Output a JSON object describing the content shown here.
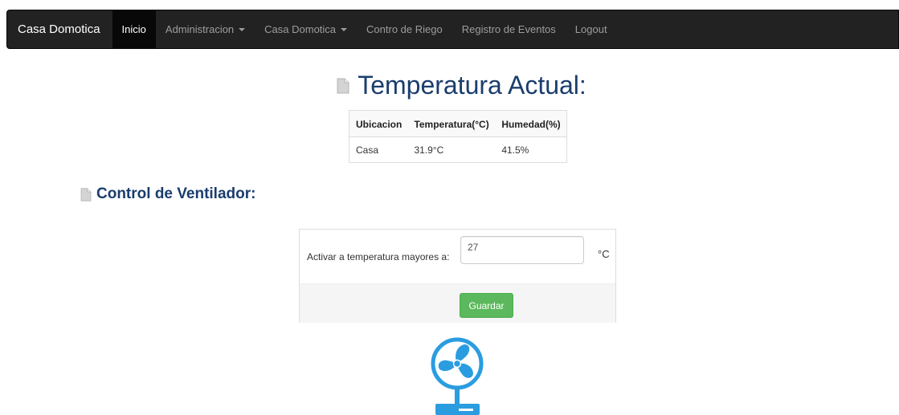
{
  "navbar": {
    "brand": "Casa Domotica",
    "items": [
      {
        "label": "Inicio",
        "active": true,
        "dropdown": false
      },
      {
        "label": "Administracion",
        "active": false,
        "dropdown": true
      },
      {
        "label": "Casa Domotica",
        "active": false,
        "dropdown": true
      },
      {
        "label": "Contro de Riego",
        "active": false,
        "dropdown": false
      },
      {
        "label": "Registro de Eventos",
        "active": false,
        "dropdown": false
      },
      {
        "label": "Logout",
        "active": false,
        "dropdown": false
      }
    ]
  },
  "main": {
    "title": "Temperatura Actual:",
    "table": {
      "headers": [
        "Ubicacion",
        "Temperatura(°C)",
        "Humedad(%)"
      ],
      "rows": [
        [
          "Casa",
          "31.9°C",
          "41.5%"
        ]
      ]
    }
  },
  "fan_control": {
    "title": "Control de Ventilador:",
    "label": "Activar a temperatura mayores a:",
    "input_value": "27",
    "unit": "°C",
    "save_label": "Guardar"
  },
  "icons": {
    "title_icon": "document-icon",
    "fan_icon": "fan-icon"
  },
  "colors": {
    "navbar_bg": "#222222",
    "title_color": "#1a3d6d",
    "save_button": "#5cb85c",
    "fan_blue": "#2a9de0"
  }
}
